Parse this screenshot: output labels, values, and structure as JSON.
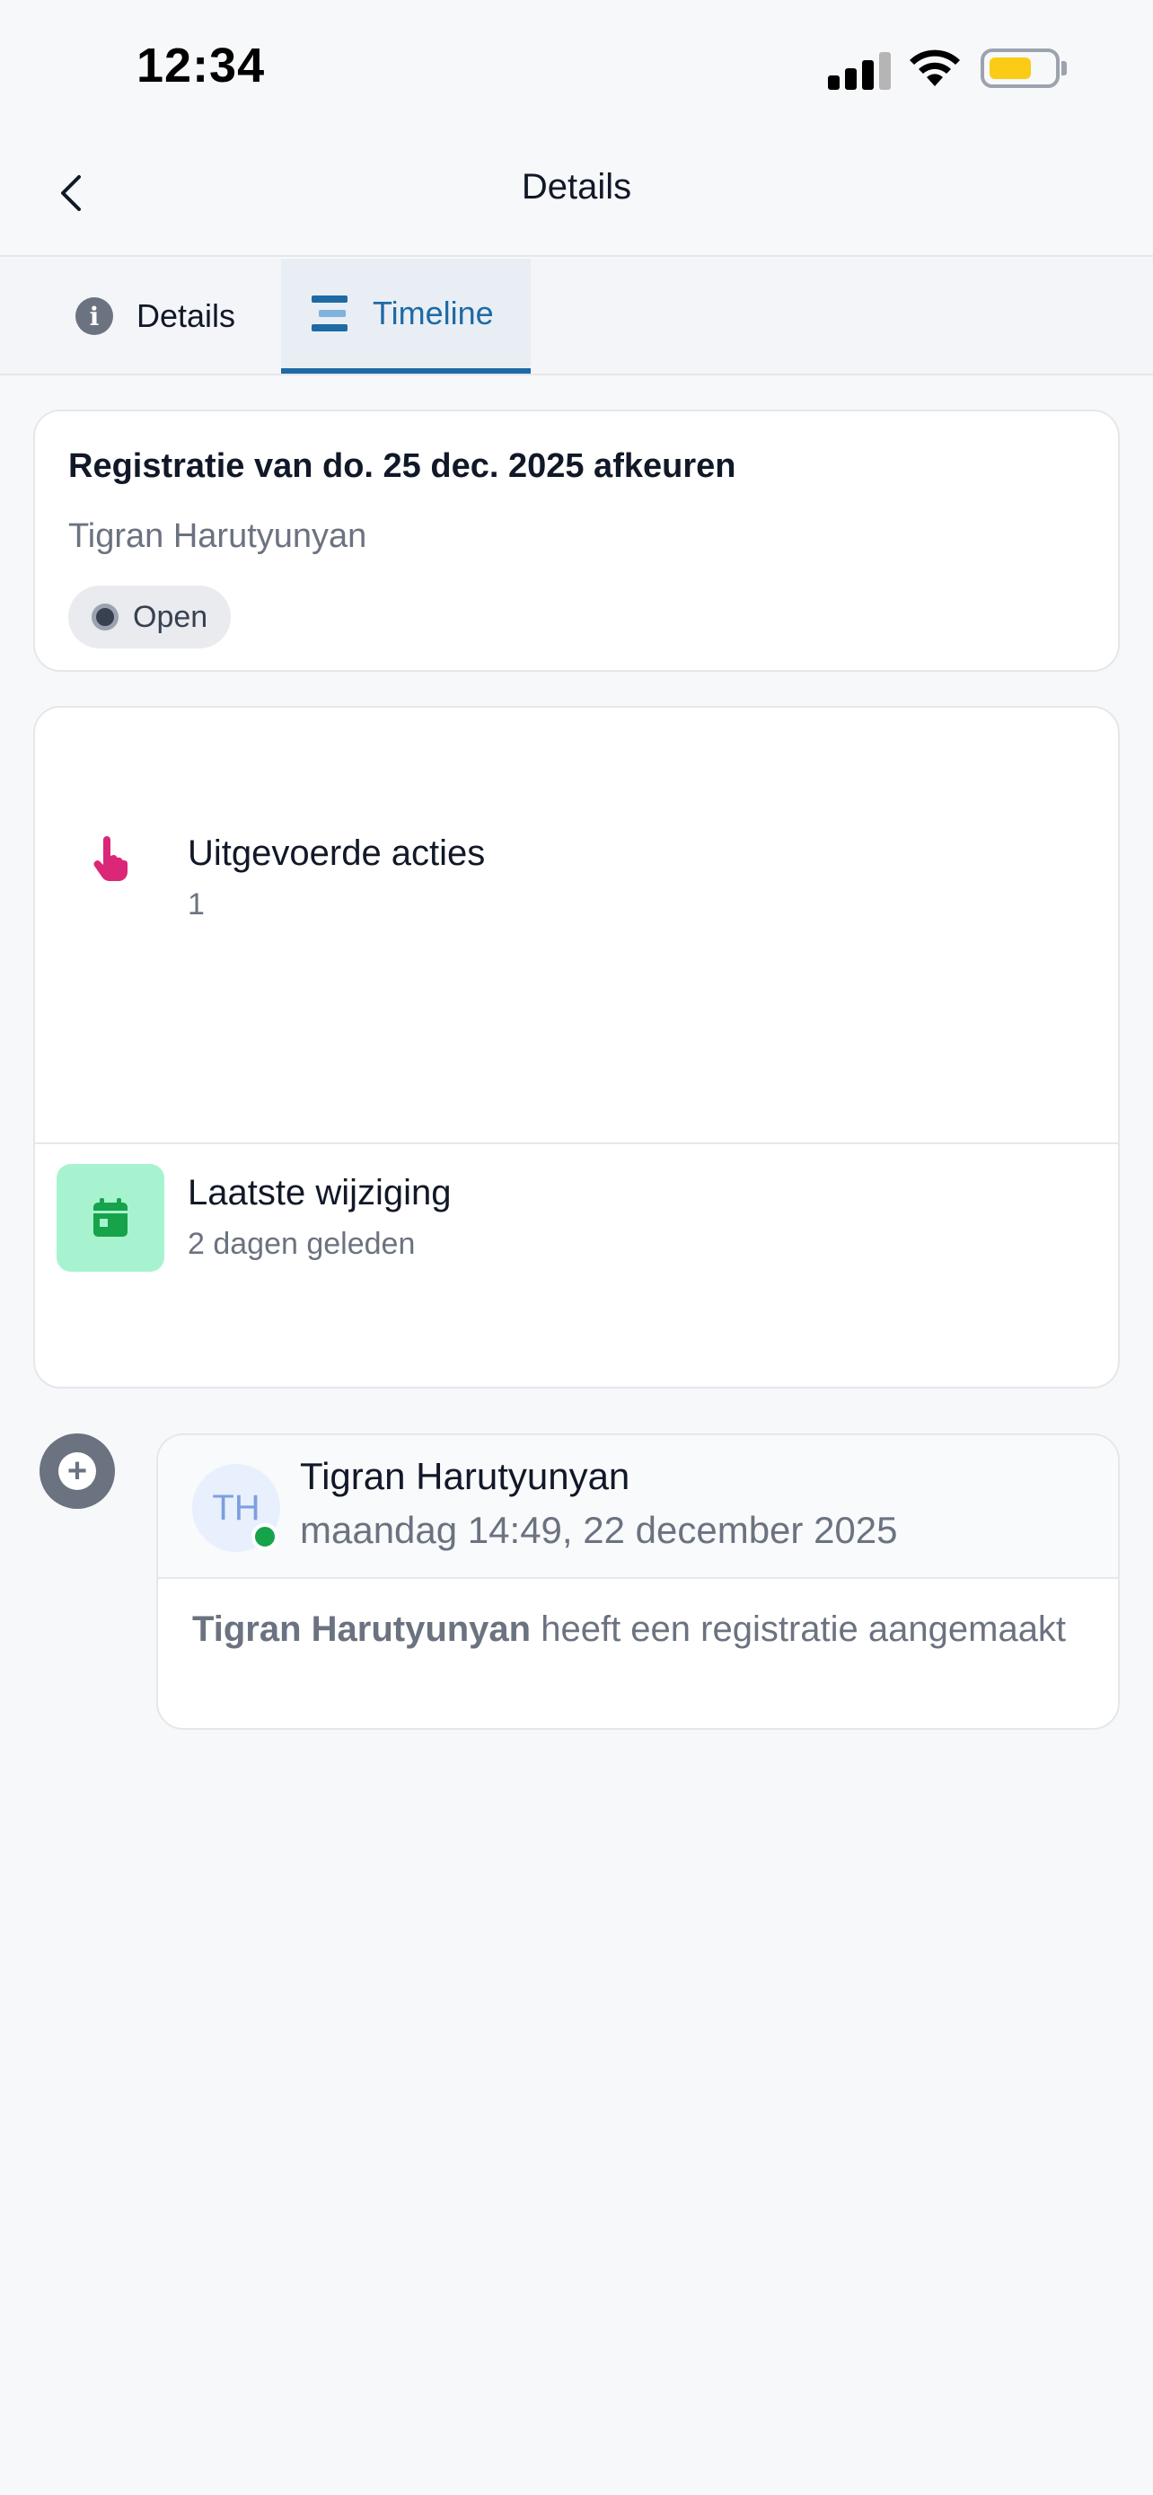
{
  "status_bar": {
    "time": "12:34"
  },
  "nav": {
    "title": "Details"
  },
  "tabs": [
    {
      "label": "Details",
      "icon": "info-icon",
      "active": false
    },
    {
      "label": "Timeline",
      "icon": "timeline-icon",
      "active": true
    }
  ],
  "registration": {
    "title_prefix": "Registratie van ",
    "title_date": "do. 25 dec. 2025",
    "title_suffix": " afkeuren",
    "person": "Tigran Harutyunyan",
    "status": "Open"
  },
  "stats": [
    {
      "label": "Uitgevoerde acties",
      "value": "1",
      "icon": "pointer-hand-icon",
      "color": "#db2777"
    },
    {
      "label": "Laatste wijziging",
      "value": "2 dagen geleden",
      "icon": "calendar-icon",
      "color": "#16a34a",
      "icon_bg": "#a7f3d0"
    }
  ],
  "timeline": [
    {
      "initials": "TH",
      "name": "Tigran Harutyunyan",
      "timestamp": "maandag 14:49, 22 december 2025",
      "actor": "Tigran Harutyunyan",
      "action": " heeft een registratie aangemaakt",
      "marker_icon": "plus-circle-icon"
    }
  ],
  "colors": {
    "accent": "#1d6aa5",
    "background": "#f7f8fa",
    "online": "#16a34a"
  }
}
